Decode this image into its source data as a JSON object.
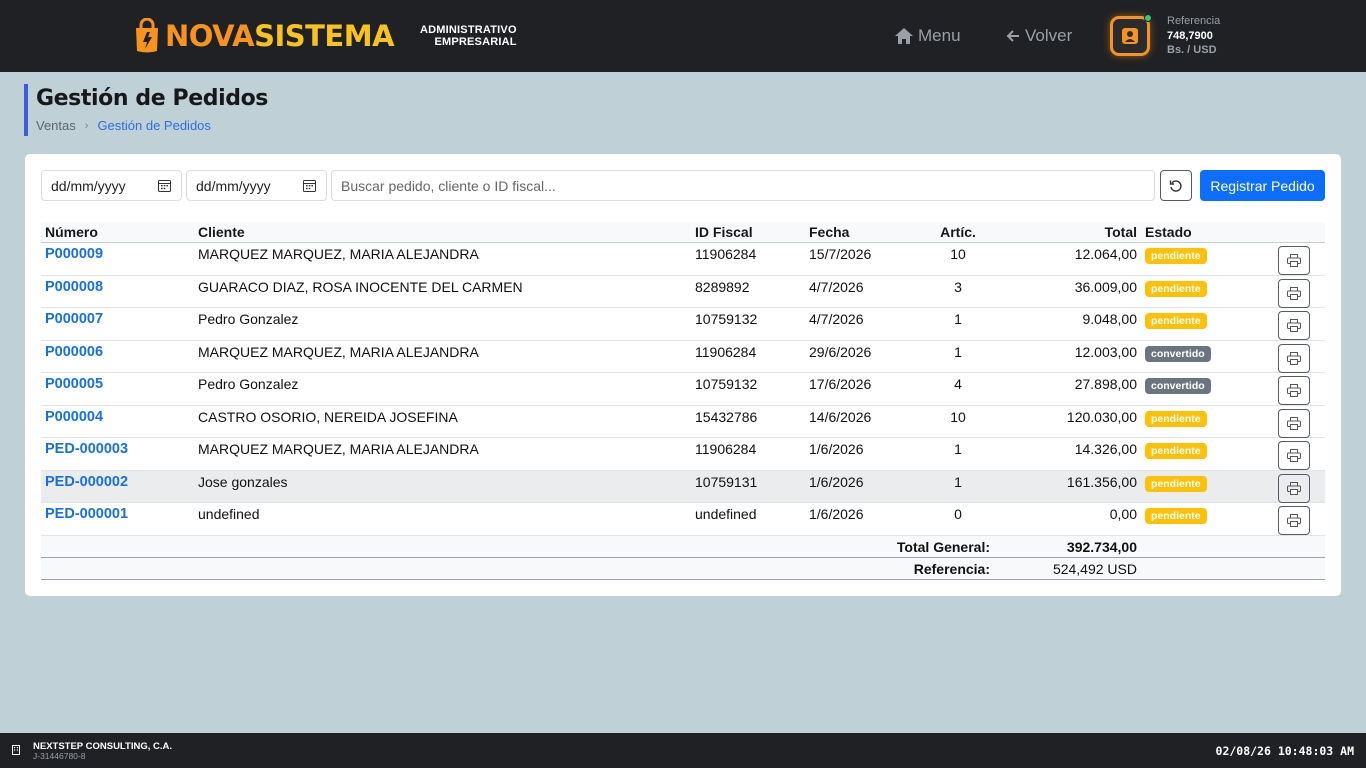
{
  "header": {
    "logo_part1": "NOVA",
    "logo_part2": "SISTEMA",
    "logo_sub_line1": "ADMINISTRATIVO",
    "logo_sub_line2": "EMPRESARIAL",
    "menu_label": "Menu",
    "back_label": "Volver",
    "reference_label": "Referencia",
    "reference_value": "748,7900",
    "reference_unit": "Bs. / USD",
    "colors": {
      "brand_orange": "#f7931e",
      "brand_yellow": "#f9c31f",
      "status_online": "#2ecc71"
    }
  },
  "page": {
    "title": "Gestión de Pedidos",
    "breadcrumb": [
      "Ventas",
      "Gestión de Pedidos"
    ]
  },
  "filters": {
    "date_from_placeholder": "dd/mm/yyyy",
    "date_to_placeholder": "dd/mm/yyyy",
    "search_placeholder": "Buscar pedido, cliente o ID fiscal...",
    "register_button": "Registrar Pedido"
  },
  "table": {
    "columns": [
      "Número",
      "Cliente",
      "ID Fiscal",
      "Fecha",
      "Artíc.",
      "Total",
      "Estado"
    ],
    "rows": [
      {
        "numero": "P000009",
        "cliente": "MARQUEZ MARQUEZ, MARIA ALEJANDRA",
        "id_fiscal": "11906284",
        "fecha": "15/7/2026",
        "articulos": "10",
        "total": "12.064,00",
        "estado": "pendiente"
      },
      {
        "numero": "P000008",
        "cliente": "GUARACO DIAZ, ROSA INOCENTE DEL CARMEN",
        "id_fiscal": "8289892",
        "fecha": "4/7/2026",
        "articulos": "3",
        "total": "36.009,00",
        "estado": "pendiente"
      },
      {
        "numero": "P000007",
        "cliente": "Pedro Gonzalez",
        "id_fiscal": "10759132",
        "fecha": "4/7/2026",
        "articulos": "1",
        "total": "9.048,00",
        "estado": "pendiente"
      },
      {
        "numero": "P000006",
        "cliente": "MARQUEZ MARQUEZ, MARIA ALEJANDRA",
        "id_fiscal": "11906284",
        "fecha": "29/6/2026",
        "articulos": "1",
        "total": "12.003,00",
        "estado": "convertido"
      },
      {
        "numero": "P000005",
        "cliente": "Pedro Gonzalez",
        "id_fiscal": "10759132",
        "fecha": "17/6/2026",
        "articulos": "4",
        "total": "27.898,00",
        "estado": "convertido"
      },
      {
        "numero": "P000004",
        "cliente": "CASTRO OSORIO, NEREIDA JOSEFINA",
        "id_fiscal": "15432786",
        "fecha": "14/6/2026",
        "articulos": "10",
        "total": "120.030,00",
        "estado": "pendiente"
      },
      {
        "numero": "PED-000003",
        "cliente": "MARQUEZ MARQUEZ, MARIA ALEJANDRA",
        "id_fiscal": "11906284",
        "fecha": "1/6/2026",
        "articulos": "1",
        "total": "14.326,00",
        "estado": "pendiente"
      },
      {
        "numero": "PED-000002",
        "cliente": "Jose gonzales",
        "id_fiscal": "10759131",
        "fecha": "1/6/2026",
        "articulos": "1",
        "total": "161.356,00",
        "estado": "pendiente"
      },
      {
        "numero": "PED-000001",
        "cliente": "undefined",
        "id_fiscal": "undefined",
        "fecha": "1/6/2026",
        "articulos": "0",
        "total": "0,00",
        "estado": "pendiente"
      }
    ],
    "total_general_label": "Total General:",
    "total_general_value": "392.734,00",
    "referencia_label": "Referencia:",
    "referencia_value": "524,492 USD",
    "status_colors": {
      "pendiente": "#ffc107",
      "convertido": "#6c757d"
    }
  },
  "footer": {
    "company": "NEXTSTEP CONSULTING, C.A.",
    "company_id": "J-31446780-8",
    "datetime": "02/08/26 10:48:03 AM"
  }
}
